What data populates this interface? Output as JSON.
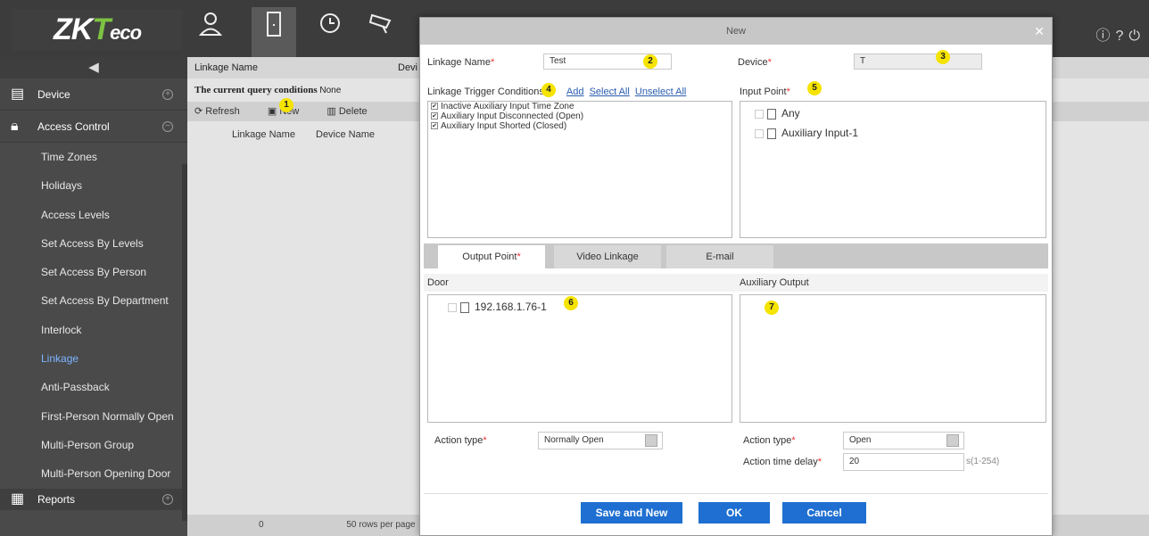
{
  "brand": {
    "logo_prefix": "ZK",
    "logo_t": "T",
    "logo_suffix": "eco"
  },
  "top_icons": [
    "person-icon",
    "door-icon",
    "clock-icon",
    "camera-icon"
  ],
  "top_right_icons": [
    "info-icon",
    "help-icon",
    "power-icon"
  ],
  "sidebar": {
    "collapse_icon": "chevron-left-circle-icon",
    "sections": [
      {
        "label": "Device",
        "icon": "device-icon",
        "toggle": "+"
      },
      {
        "label": "Access Control",
        "icon": "lock-icon",
        "toggle": "−"
      }
    ],
    "items": [
      "Time Zones",
      "Holidays",
      "Access Levels",
      "Set Access By Levels",
      "Set Access By Person",
      "Set Access By Department",
      "Interlock",
      "Linkage",
      "Anti-Passback",
      "First-Person Normally Open",
      "Multi-Person Group",
      "Multi-Person Opening Door"
    ],
    "active_index": 7,
    "reports": {
      "label": "Reports",
      "icon": "reports-icon",
      "toggle": "+"
    }
  },
  "main": {
    "filter_label": "Linkage Name",
    "filter_device": "Devi",
    "query_label": "The current query conditions",
    "query_value": "None",
    "toolbar": {
      "refresh": "Refresh",
      "new": "New",
      "delete": "Delete"
    },
    "columns": [
      "Linkage Name",
      "Device Name"
    ],
    "pager": {
      "count": "0",
      "rows_per_page": "50 rows per page"
    }
  },
  "dialog": {
    "title": "New",
    "linkage_name_label": "Linkage Name",
    "linkage_name_value": "Test",
    "device_label": "Device",
    "device_value": "T",
    "trigger_label": "Linkage Trigger Conditions",
    "trigger_links": {
      "add": "Add",
      "select_all": "Select All",
      "unselect_all": "Unselect All"
    },
    "triggers": [
      "Inactive Auxiliary Input Time Zone",
      "Auxiliary Input Disconnected (Open)",
      "Auxiliary Input Shorted (Closed)"
    ],
    "input_point_label": "Input Point",
    "input_points": [
      "Any",
      "Auxiliary Input-1"
    ],
    "tabs": [
      "Output Point",
      "Video Linkage",
      "E-mail"
    ],
    "door_label": "Door",
    "doors": [
      "192.168.1.76-1"
    ],
    "aux_output_label": "Auxiliary Output",
    "door_action_type_label": "Action type",
    "door_action_type_value": "Normally Open",
    "aux_action_type_label": "Action type",
    "aux_action_type_value": "Open",
    "action_delay_label": "Action time delay",
    "action_delay_value": "20",
    "action_delay_unit": "s(1-254)",
    "buttons": {
      "save_new": "Save and New",
      "ok": "OK",
      "cancel": "Cancel"
    }
  },
  "badges": [
    "1",
    "2",
    "3",
    "4",
    "5",
    "6",
    "7"
  ]
}
